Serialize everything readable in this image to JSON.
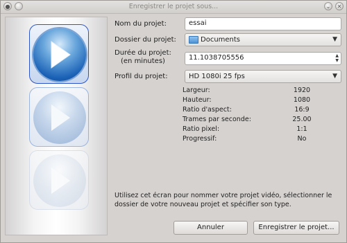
{
  "window": {
    "title": "Enregistrer le projet sous..."
  },
  "form": {
    "name_label": "Nom du projet:",
    "name_value": "essai",
    "folder_label": "Dossier du projet:",
    "folder_value": "Documents",
    "duration_label_line1": "Durée du projet:",
    "duration_label_line2": "(en minutes)",
    "duration_value": "11.1038705556",
    "profile_label": "Profil du projet:",
    "profile_value": "HD 1080i 25 fps"
  },
  "properties": [
    {
      "key": "Largeur:",
      "value": "1920"
    },
    {
      "key": "Hauteur:",
      "value": "1080"
    },
    {
      "key": "Ratio d'aspect:",
      "value": "16:9"
    },
    {
      "key": "Trames par seconde:",
      "value": "25.00"
    },
    {
      "key": "Ratio pixel:",
      "value": "1:1"
    },
    {
      "key": "Progressif:",
      "value": "No"
    }
  ],
  "description": "Utilisez cet écran pour nommer votre projet vidéo, sélectionner le dossier de votre nouveau projet et spécifier son type.",
  "buttons": {
    "cancel": "Annuler",
    "save": "Enregistrer le projet..."
  },
  "colors": {
    "accent": "#2c55c8",
    "window_bg": "#d6d2d0"
  },
  "icons": [
    "app-icon",
    "minimize-icon",
    "close-icon",
    "play-icon",
    "folder-icon",
    "chevron-down-icon"
  ]
}
